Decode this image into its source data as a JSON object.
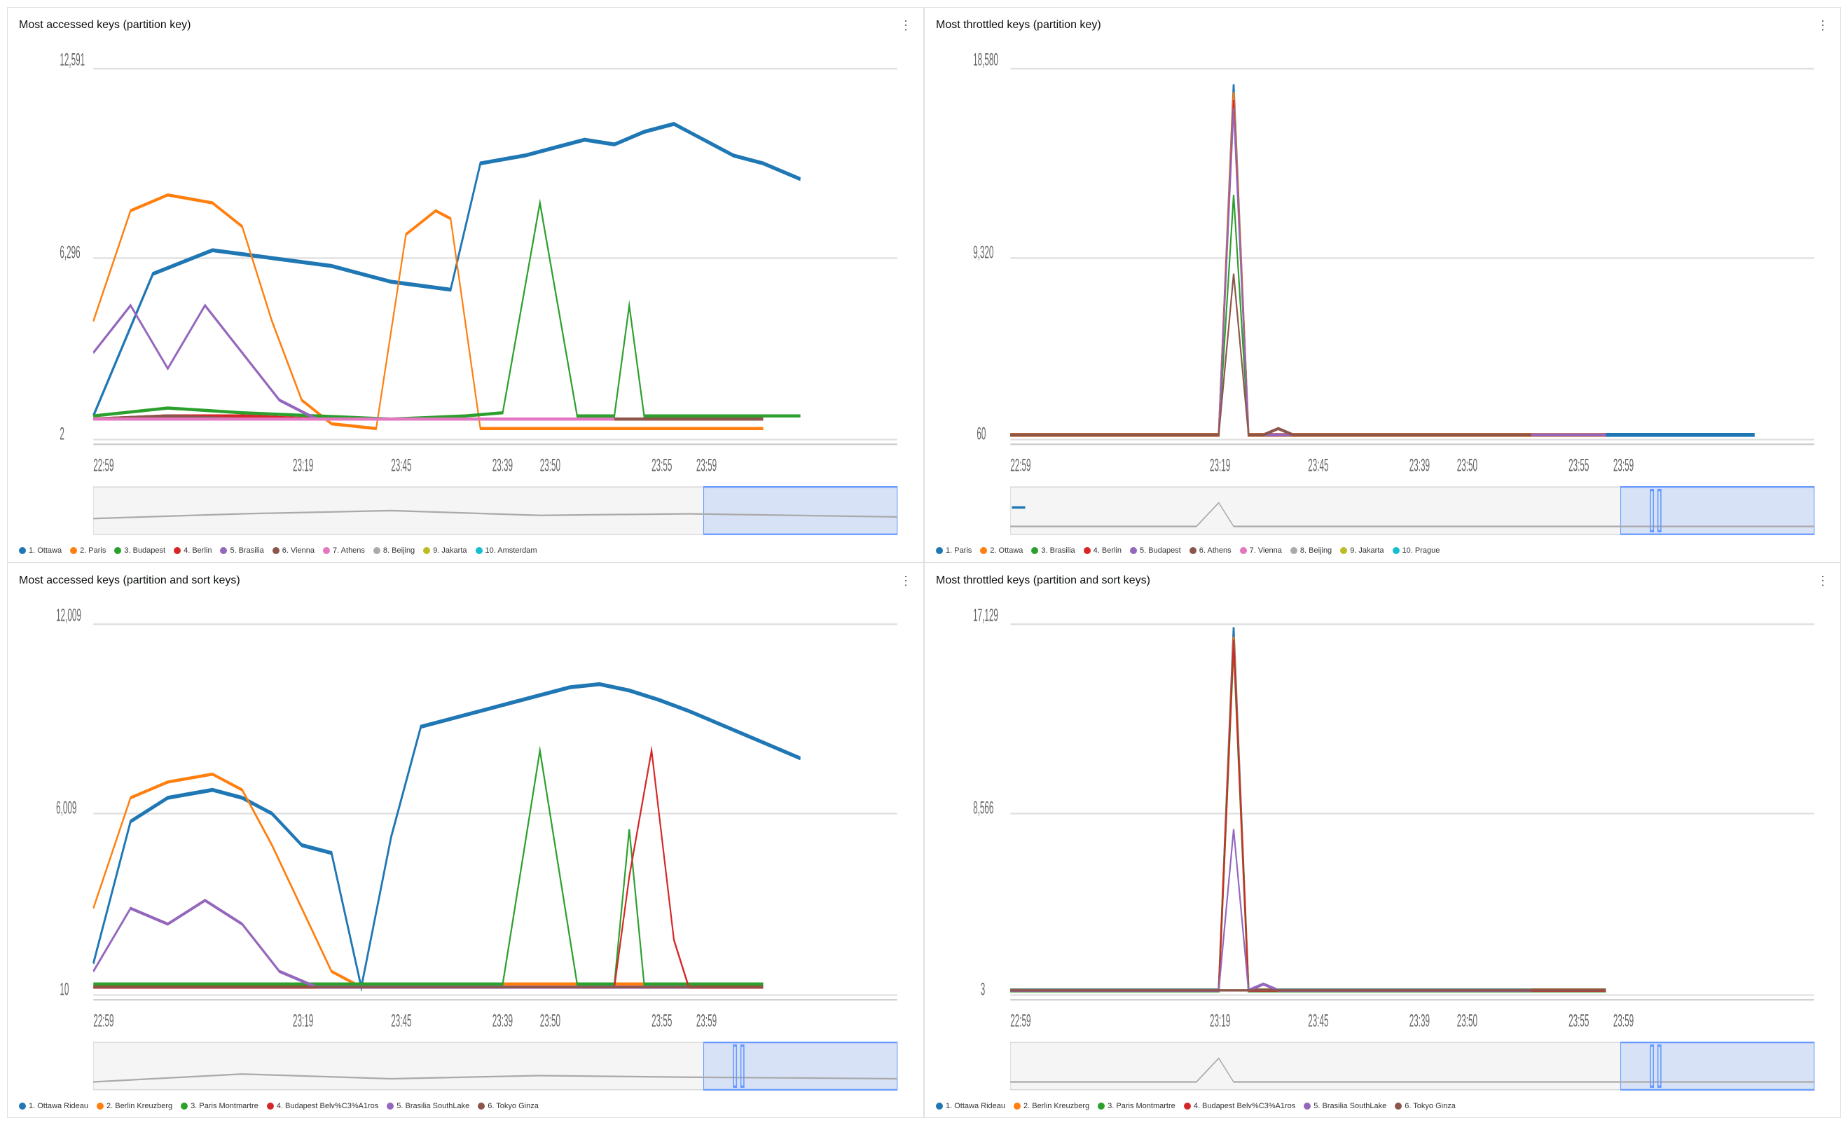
{
  "panels": [
    {
      "id": "panel-1",
      "title": "Most accessed keys (partition key)",
      "y_labels": [
        "12,591",
        "6,296",
        "2"
      ],
      "x_labels": [
        "22:59",
        "23:19",
        "23:39",
        "23:59"
      ],
      "x_ticks": [
        "23:45",
        "23:50",
        "23:55"
      ],
      "legend": [
        {
          "label": "1. Ottawa",
          "color": "#1f77b4",
          "type": "dot"
        },
        {
          "label": "2. Paris",
          "color": "#ff7f0e",
          "type": "dot"
        },
        {
          "label": "3. Budapest",
          "color": "#2ca02c",
          "type": "dot"
        },
        {
          "label": "4. Berlin",
          "color": "#d62728",
          "type": "dot"
        },
        {
          "label": "5. Brasilia",
          "color": "#9467bd",
          "type": "dot"
        },
        {
          "label": "6. Vienna",
          "color": "#8c564b",
          "type": "dot"
        },
        {
          "label": "7. Athens",
          "color": "#e377c2",
          "type": "dot"
        },
        {
          "label": "8. Beijing",
          "color": "#aaa",
          "type": "dot"
        },
        {
          "label": "9. Jakarta",
          "color": "#bcbd22",
          "type": "dot"
        },
        {
          "label": "10. Amsterdam",
          "color": "#17becf",
          "type": "dot"
        }
      ]
    },
    {
      "id": "panel-2",
      "title": "Most throttled keys (partition key)",
      "y_labels": [
        "18,580",
        "9,320",
        "60"
      ],
      "x_labels": [
        "22:59",
        "23:19",
        "23:39",
        "23:59"
      ],
      "x_ticks": [
        "23:45",
        "23:50",
        "23:55"
      ],
      "legend": [
        {
          "label": "1. Paris",
          "color": "#1f77b4",
          "type": "dot"
        },
        {
          "label": "2. Ottawa",
          "color": "#ff7f0e",
          "type": "dot"
        },
        {
          "label": "3. Brasilia",
          "color": "#2ca02c",
          "type": "dot"
        },
        {
          "label": "4. Berlin",
          "color": "#d62728",
          "type": "dot"
        },
        {
          "label": "5. Budapest",
          "color": "#9467bd",
          "type": "dot"
        },
        {
          "label": "6. Athens",
          "color": "#8c564b",
          "type": "dot"
        },
        {
          "label": "7. Vienna",
          "color": "#e377c2",
          "type": "dot"
        },
        {
          "label": "8. Beijing",
          "color": "#aaa",
          "type": "dot"
        },
        {
          "label": "9. Jakarta",
          "color": "#bcbd22",
          "type": "dot"
        },
        {
          "label": "10. Prague",
          "color": "#17becf",
          "type": "dot"
        }
      ]
    },
    {
      "id": "panel-3",
      "title": "Most accessed keys (partition and sort keys)",
      "y_labels": [
        "12,009",
        "6,009",
        "10"
      ],
      "x_labels": [
        "22:59",
        "23:19",
        "23:39",
        "23:59"
      ],
      "x_ticks": [
        "23:45",
        "23:50",
        "23:55"
      ],
      "legend": [
        {
          "label": "1. Ottawa Rideau",
          "color": "#1f77b4",
          "type": "dot"
        },
        {
          "label": "2. Berlin Kreuzberg",
          "color": "#ff7f0e",
          "type": "dot"
        },
        {
          "label": "3. Paris Montmartre",
          "color": "#2ca02c",
          "type": "dot"
        },
        {
          "label": "4. Budapest Belv%C3%A1ros",
          "color": "#d62728",
          "type": "dot"
        },
        {
          "label": "5. Brasilia SouthLake",
          "color": "#9467bd",
          "type": "dot"
        },
        {
          "label": "6. Tokyo Ginza",
          "color": "#8c564b",
          "type": "dot"
        }
      ]
    },
    {
      "id": "panel-4",
      "title": "Most throttled keys (partition and sort keys)",
      "y_labels": [
        "17,129",
        "8,566",
        "3"
      ],
      "x_labels": [
        "22:59",
        "23:19",
        "23:39",
        "23:59"
      ],
      "x_ticks": [
        "23:45",
        "23:50",
        "23:55"
      ],
      "legend": [
        {
          "label": "1. Ottawa Rideau",
          "color": "#1f77b4",
          "type": "dot"
        },
        {
          "label": "2. Berlin Kreuzberg",
          "color": "#ff7f0e",
          "type": "dot"
        },
        {
          "label": "3. Paris Montmartre",
          "color": "#2ca02c",
          "type": "dot"
        },
        {
          "label": "4. Budapest Belv%C3%A1ros",
          "color": "#d62728",
          "type": "dot"
        },
        {
          "label": "5. Brasilia SouthLake",
          "color": "#9467bd",
          "type": "dot"
        },
        {
          "label": "6. Tokyo Ginza",
          "color": "#8c564b",
          "type": "dot"
        }
      ]
    }
  ],
  "menu_icon": "⋮"
}
